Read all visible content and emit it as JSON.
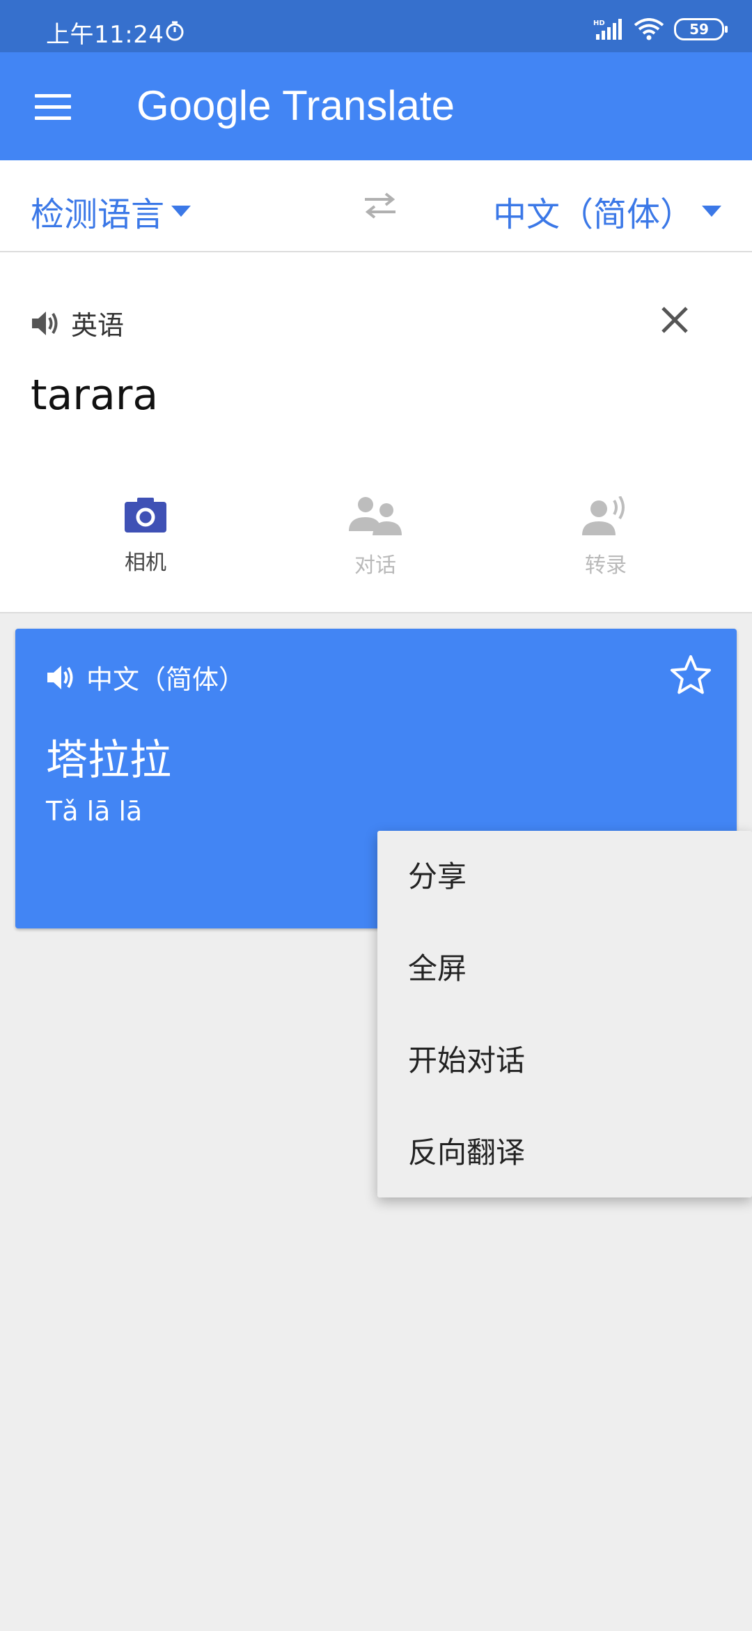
{
  "status_bar": {
    "time": "上午11:24",
    "battery": "59"
  },
  "app_bar": {
    "title_google": "Google",
    "title_translate": "Translate"
  },
  "language_bar": {
    "source": "检测语言",
    "target": "中文（简体）"
  },
  "input": {
    "detected_language": "英语",
    "text": "tarara"
  },
  "tools": {
    "camera": "相机",
    "conversation": "对话",
    "transcribe": "转录"
  },
  "result": {
    "language": "中文（简体）",
    "text": "塔拉拉",
    "pinyin": "Tǎ lā lā"
  },
  "popup_menu": {
    "items": [
      "分享",
      "全屏",
      "开始对话",
      "反向翻译"
    ]
  },
  "colors": {
    "status_bar": "#3670cd",
    "app_bar": "#4285f4",
    "accent_text": "#3b78e7",
    "camera_icon": "#3f51b5"
  }
}
